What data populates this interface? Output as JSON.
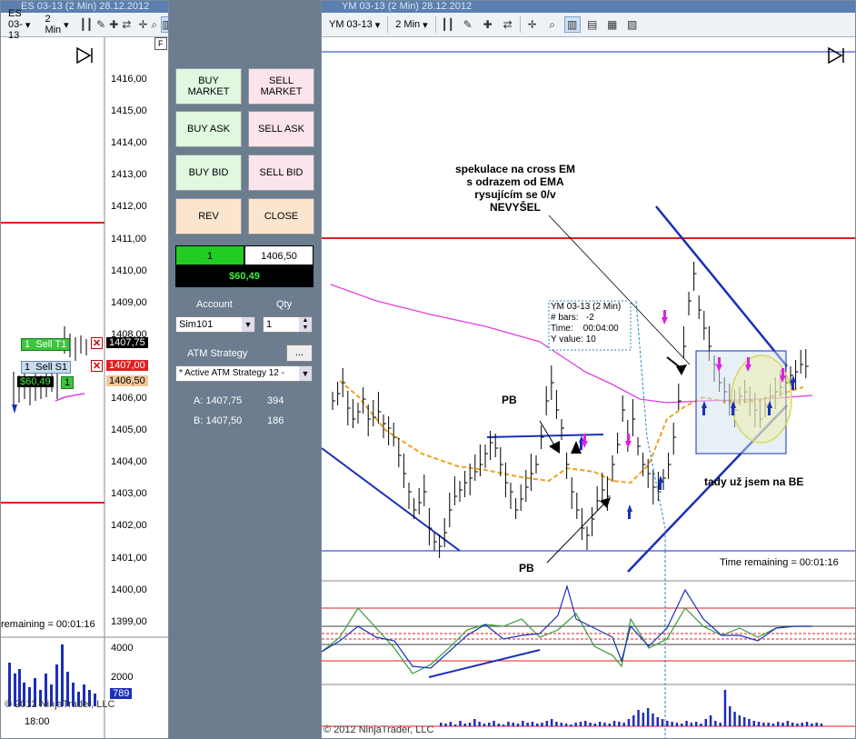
{
  "left_window": {
    "title": "ES 03-13 (2 Min)  28.12.2012",
    "instrument": "ES 03-13",
    "interval": "2 Min",
    "price_ticks": [
      "1416,00",
      "1415,00",
      "1414,00",
      "1413,00",
      "1412,00",
      "1411,00",
      "1410,00",
      "1409,00",
      "1408,00",
      "1407,00",
      "1406,00",
      "1405,00",
      "1404,00",
      "1403,00",
      "1402,00",
      "1401,00",
      "1400,00",
      "1399,00"
    ],
    "orders": {
      "sell_t1": {
        "qty": "1",
        "label": "Sell T1",
        "price": "1407,75"
      },
      "sell_s1": {
        "qty": "1",
        "label": "Sell S1",
        "price": "1407,00"
      },
      "position": {
        "pnl": "$60,49",
        "qty": "1",
        "price": "1406,50"
      }
    },
    "time_remaining": "remaining = 00:01:16",
    "volume_ticks": [
      "4000",
      "2000"
    ],
    "volume_badge": "789",
    "time_label": "18:00",
    "copyright": "© 2012 NinjaTrader, LLC"
  },
  "order_panel": {
    "buttons": {
      "buy_market": "BUY MARKET",
      "sell_market": "SELL MARKET",
      "buy_ask": "BUY ASK",
      "sell_ask": "SELL ASK",
      "buy_bid": "BUY BID",
      "sell_bid": "SELL BID",
      "rev": "REV",
      "close": "CLOSE"
    },
    "position_qty": "1",
    "position_price": "1406,50",
    "pnl": "$60,49",
    "account_label": "Account",
    "qty_label": "Qty",
    "account_value": "Sim101",
    "qty_value": "1",
    "atm_label": "ATM Strategy",
    "atm_button": "...",
    "atm_value": "* Active ATM Strategy 12 -",
    "ask_line": {
      "label": "A: 1407,75",
      "size": "394"
    },
    "bid_line": {
      "label": "B: 1407,50",
      "size": "186"
    },
    "f_label": "F"
  },
  "right_window": {
    "title": "YM 03-13 (2 Min)  28.12.2012",
    "instrument": "YM 03-13",
    "interval": "2 Min",
    "annotation_main": [
      "spekulace na cross EM",
      "s odrazem od EMA",
      "rysujícím se 0/v",
      "NEVYŠEL"
    ],
    "annotation_pb1": "PB",
    "annotation_pb2": "PB",
    "annotation_be": "tady už jsem na BE",
    "tooltip": {
      "title": "YM 03-13 (2 Min)",
      "bars_label": "# bars:",
      "bars_value": "-2",
      "time_label": "Time:",
      "time_value": "00:04:00",
      "y_label": "Y value:",
      "y_value": "10"
    },
    "time_remaining": "Time remaining = 00:01:16",
    "copyright": "© 2012 NinjaTrader, LLC"
  },
  "colors": {
    "title_bar": "#5a7fb0",
    "red_line": "#e02020",
    "blue_line": "#1a2fb8",
    "ema_orange": "#f0a020",
    "ma_magenta": "#e040e0",
    "panel_bg": "#6b7d8f"
  }
}
